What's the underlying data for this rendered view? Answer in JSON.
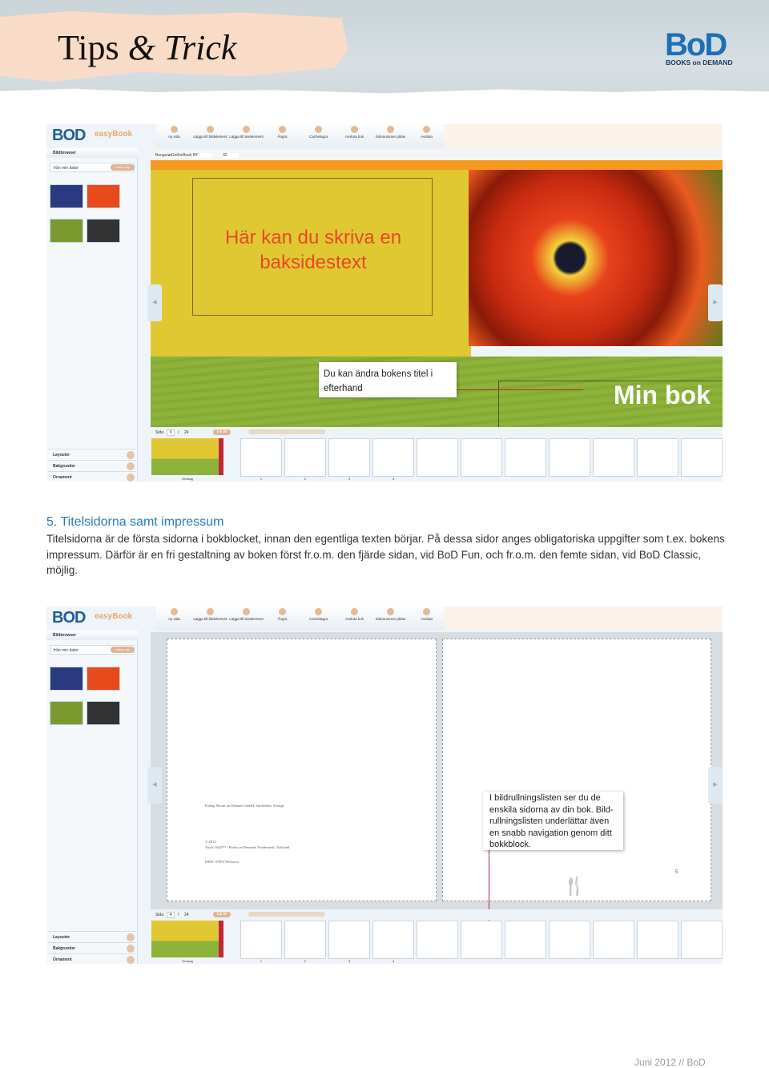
{
  "header": {
    "title_a": "Tips",
    "title_amp": "&",
    "title_b": "Trick",
    "logo": "BoD",
    "logo_sub": "BOOKS on DEMAND"
  },
  "app": {
    "logo": "BOD",
    "logo_name": "easyBook",
    "toolbar": [
      "ny sida",
      "Lägga till bildelement",
      "Lägga till textelement",
      "Ångra",
      "Cachelagra",
      "Avsluta bok",
      "Sidonummer på/av",
      "Avsluta"
    ],
    "sidebar": {
      "header": "Bildbrowser",
      "source": "från min dator",
      "upload": "Ladda upp",
      "sections": [
        "Layouter",
        "Bakgrunder",
        "Ornament"
      ]
    },
    "font_name": "BenguiatGothicBook BT",
    "font_size": "32",
    "page_label": "Sida",
    "page_sep": "/",
    "page_total": "24",
    "goto": "Gå till",
    "cover_label": "Omslag",
    "page_numbers": [
      "1",
      "2",
      "3",
      "4"
    ]
  },
  "shot1": {
    "current_page": "0",
    "back_text": "Här kan du skriva en baksidestext",
    "spine_title": "Min bok",
    "callout": "Du kan ändra bokens titel i efterhand"
  },
  "section": {
    "heading": "5. Titelsidorna samt impressum",
    "body": "Titelsidorna är de första sidorna i bokblocket, innan den egentliga texten börjar.  På dessa sidor anges obligatoriska uppgifter som t.ex. bokens impressum. Därför är en fri gestaltning av boken först fr.o.m. den fjärde sidan, vid BoD Fun, och fr.o.m. den femte sidan, vid BoD Classic, möjlig."
  },
  "shot2": {
    "current_page": "4",
    "impressum": [
      "Förlag: Books on Demand GmbH, Stockholm, Sverige",
      "© 2012",
      "Tryck: BoD™ - Books on Demand, Norderstedt, Tyskland",
      "ISBN: 978917463xxxx"
    ],
    "page_number": "5",
    "callout": "I bildrullningslisten ser du de enskila sidorna av din bok. Bild-rullningslisten underlättar även en snabb navigation genom ditt bokkblock."
  },
  "footer": {
    "text": "Juni 2012  //  BoD"
  },
  "colors": {
    "heading": "#2a7ab8",
    "orange": "#f59a1f",
    "yellow": "#e0c832",
    "green": "#8db33a",
    "callout_line": "#c0283a"
  }
}
